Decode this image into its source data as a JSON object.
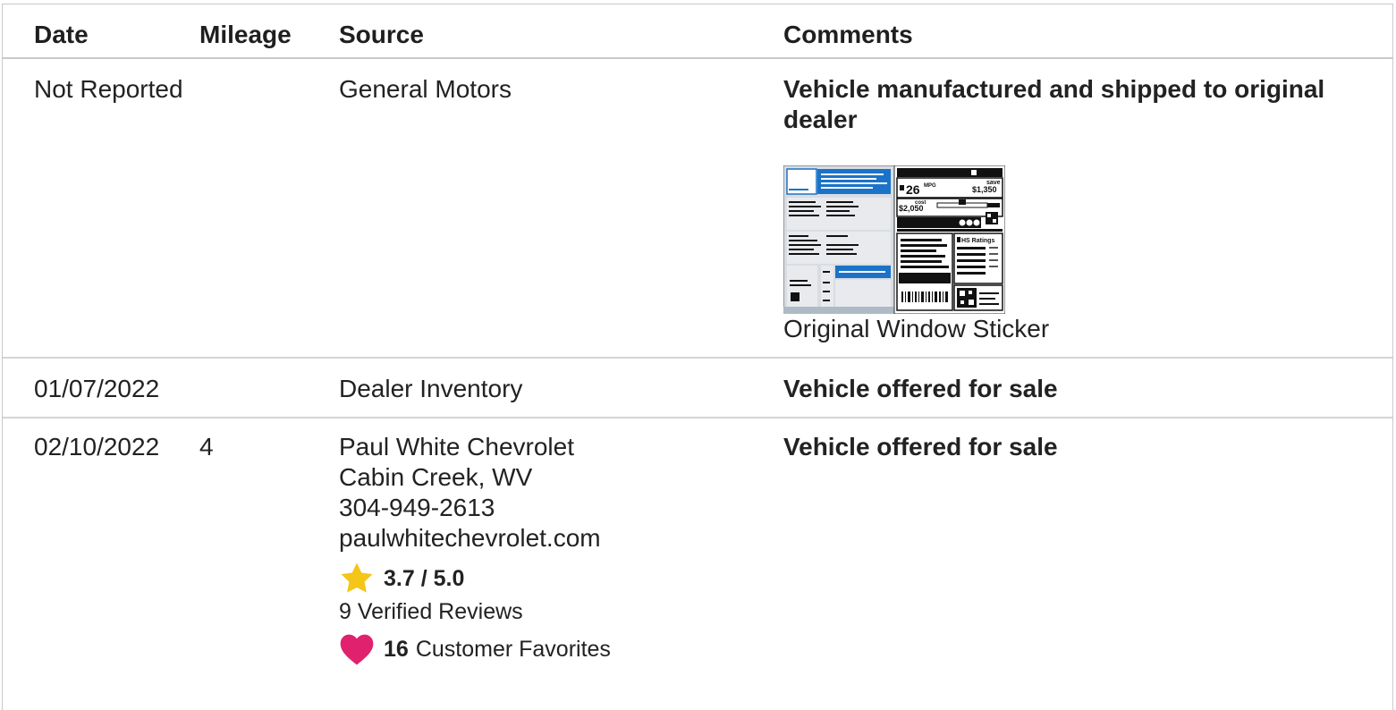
{
  "headers": {
    "date": "Date",
    "mileage": "Mileage",
    "source": "Source",
    "comments": "Comments"
  },
  "rows": [
    {
      "date": "Not Reported",
      "mileage": "",
      "source": "General Motors",
      "comment": "Vehicle manufactured and shipped to original dealer",
      "sticker_caption": "Original Window Sticker",
      "sticker": {
        "mpg": "26",
        "mpg_unit": "MPG",
        "save_label": "save",
        "save_amount": "$1,350",
        "fuel_cost_label": "cost",
        "fuel_cost": "$2,050",
        "ratings_label": "HS Ratings"
      }
    },
    {
      "date": "01/07/2022",
      "mileage": "",
      "source": "Dealer Inventory",
      "comment": "Vehicle offered for sale"
    },
    {
      "date": "02/10/2022",
      "mileage": "4",
      "source_lines": [
        "Paul White Chevrolet",
        "Cabin Creek, WV",
        "304-949-2613",
        "paulwhitechevrolet.com"
      ],
      "rating": "3.7 / 5.0",
      "reviews": "9 Verified Reviews",
      "favorites_count": "16",
      "favorites_label": "Customer Favorites",
      "comment": "Vehicle offered for sale"
    }
  ],
  "colors": {
    "star": "#f5c518",
    "heart": "#e0226e",
    "sticker_blue": "#1a73c8",
    "border": "#c9c9c9"
  }
}
